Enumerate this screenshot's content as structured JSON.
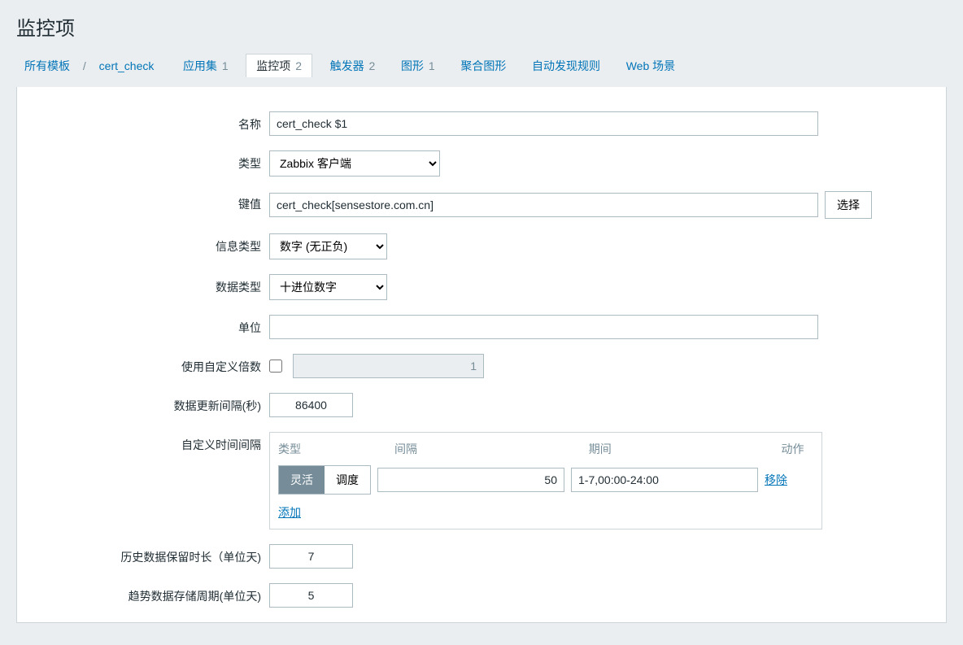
{
  "page": {
    "title": "监控项"
  },
  "nav": {
    "all_templates": "所有模板",
    "template_name": "cert_check",
    "applications": {
      "label": "应用集",
      "count": "1"
    },
    "items": {
      "label": "监控项",
      "count": "2"
    },
    "triggers": {
      "label": "触发器",
      "count": "2"
    },
    "graphs": {
      "label": "图形",
      "count": "1"
    },
    "screens": {
      "label": "聚合图形"
    },
    "discovery": {
      "label": "自动发现规则"
    },
    "web": {
      "label": "Web 场景"
    }
  },
  "form": {
    "name": {
      "label": "名称",
      "value": "cert_check $1"
    },
    "type": {
      "label": "类型",
      "value": "Zabbix 客户端"
    },
    "key": {
      "label": "键值",
      "value": "cert_check[sensestore.com.cn]",
      "select_btn": "选择"
    },
    "info_type": {
      "label": "信息类型",
      "value": "数字 (无正负)"
    },
    "data_type": {
      "label": "数据类型",
      "value": "十进位数字"
    },
    "units": {
      "label": "单位",
      "value": ""
    },
    "multiplier": {
      "label": "使用自定义倍数",
      "checked": false,
      "value": "1"
    },
    "update_interval": {
      "label": "数据更新间隔(秒)",
      "value": "86400"
    },
    "custom_interval": {
      "label": "自定义时间间隔",
      "headers": {
        "type": "类型",
        "interval": "间隔",
        "period": "期间",
        "action": "动作"
      },
      "segmented": {
        "flexible": "灵活",
        "scheduling": "调度"
      },
      "row": {
        "interval": "50",
        "period": "1-7,00:00-24:00",
        "remove": "移除"
      },
      "add": "添加"
    },
    "history": {
      "label": "历史数据保留时长（单位天)",
      "value": "7"
    },
    "trend": {
      "label": "趋势数据存储周期(单位天)",
      "value": "5"
    }
  }
}
